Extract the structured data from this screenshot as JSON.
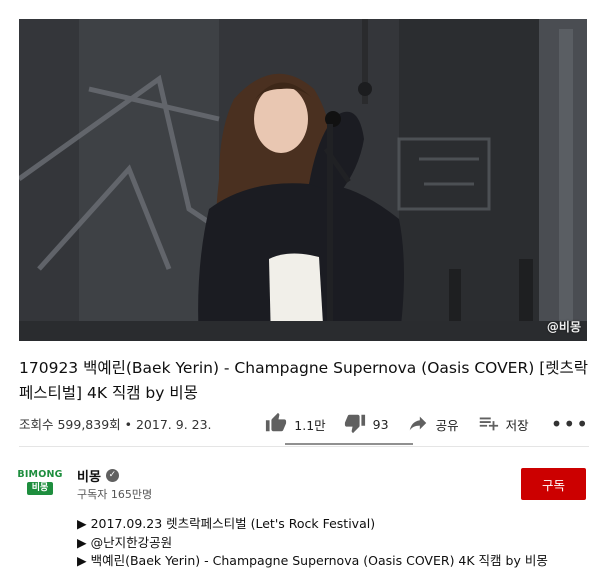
{
  "video": {
    "watermark": "@비몽"
  },
  "title": "170923 백예린(Baek Yerin) - Champagne Supernova (Oasis COVER) [렛츠락페스티벌] 4K 직캠 by 비몽",
  "meta": {
    "views": "조회수 599,839회 • 2017. 9. 23.",
    "likes": "1.1만",
    "dislikes": "93",
    "share": "공유",
    "save": "저장",
    "more": "•••",
    "like_ratio": 0.99
  },
  "channel": {
    "avatar_top": "BIMONG",
    "avatar_bottom": "비몽",
    "name": "비몽",
    "subscribers": "구독자 165만명",
    "subscribe_label": "구독",
    "subscribe_color": "#cc0000"
  },
  "description": [
    "▶ 2017.09.23 렛츠락페스티벌 (Let's Rock Festival)",
    "▶ @난지한강공원",
    "▶ 백예린(Baek Yerin) - Champagne Supernova (Oasis COVER) 4K 직캠 by 비몽"
  ],
  "icons": {
    "like": "thumb-up-icon",
    "dislike": "thumb-down-icon",
    "share": "share-icon",
    "save": "playlist-add-icon",
    "verified": "check-circle-icon"
  }
}
